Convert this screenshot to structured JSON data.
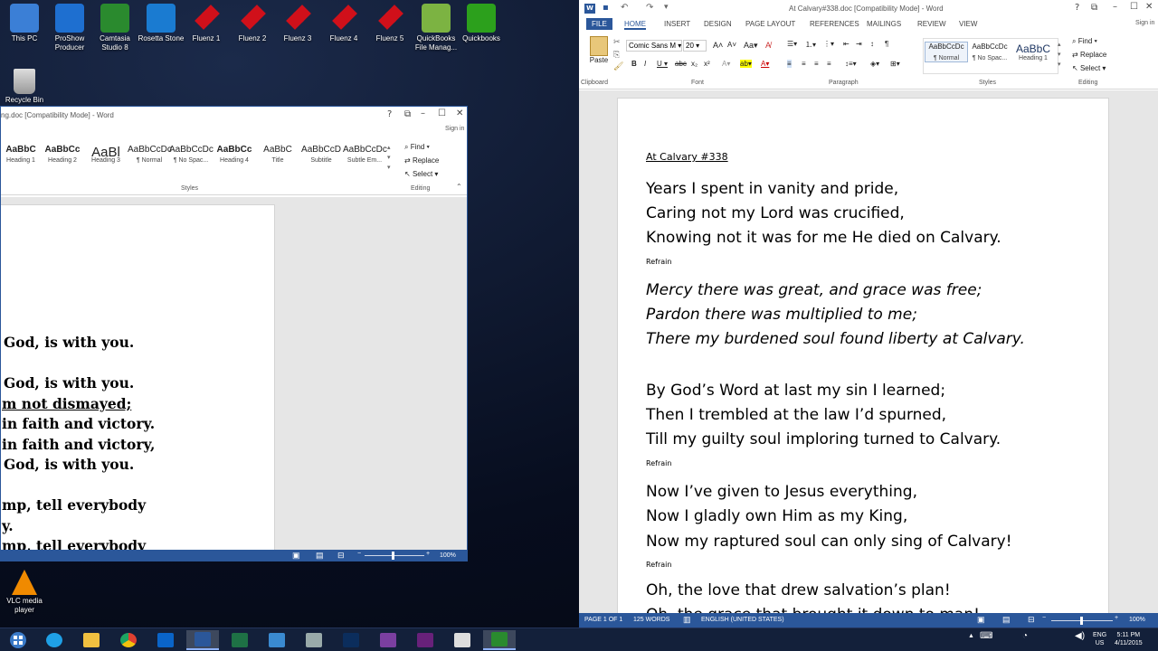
{
  "desktop": {
    "icons": [
      {
        "label": "This PC",
        "icon": "computer-icon",
        "color": "#3b7fd6"
      },
      {
        "label": "ProShow Producer",
        "icon": "proshow-icon",
        "color": "#1e6fd0"
      },
      {
        "label": "Camtasia Studio 8",
        "icon": "camtasia-icon",
        "color": "#2a8a2e"
      },
      {
        "label": "Rosetta Stone",
        "icon": "rosetta-icon",
        "color": "#1a7bd1"
      },
      {
        "label": "Fluenz 1",
        "icon": "fluenz-icon",
        "color": "#d0101a"
      },
      {
        "label": "Fluenz 2",
        "icon": "fluenz-icon",
        "color": "#d0101a"
      },
      {
        "label": "Fluenz 3",
        "icon": "fluenz-icon",
        "color": "#d0101a"
      },
      {
        "label": "Fluenz 4",
        "icon": "fluenz-icon",
        "color": "#d0101a"
      },
      {
        "label": "Fluenz 5",
        "icon": "fluenz-icon",
        "color": "#d0101a"
      },
      {
        "label": "QuickBooks File Manag...",
        "icon": "quickbooks-file-icon",
        "color": "#7cb342"
      },
      {
        "label": "Quickbooks",
        "icon": "quickbooks-icon",
        "color": "#2ca01c"
      }
    ],
    "recycle_bin": "Recycle Bin",
    "vlc": "VLC media player"
  },
  "win1": {
    "title": "ng.doc [Compatibility Mode] - Word",
    "help": "?",
    "sign_in": "Sign in",
    "styles": [
      {
        "sample": "AaBbC",
        "name": "Heading 1"
      },
      {
        "sample": "AaBbCc",
        "name": "Heading 2"
      },
      {
        "sample": "AaBl",
        "name": "Heading 3"
      },
      {
        "sample": "AaBbCcDc",
        "name": "¶ Normal"
      },
      {
        "sample": "AaBbCcDc",
        "name": "¶ No Spac..."
      },
      {
        "sample": "AaBbCc",
        "name": "Heading 4"
      },
      {
        "sample": "AaBbC",
        "name": "Title"
      },
      {
        "sample": "AaBbCcD",
        "name": "Subtitle"
      },
      {
        "sample": "AaBbCcDc",
        "name": "Subtle Em..."
      }
    ],
    "styles_label": "Styles",
    "editing_label": "Editing",
    "find": "Find",
    "replace": "Replace",
    "select": "Select",
    "lines": [
      "God, is with you.",
      "God, is with you.",
      "m not dismayed;",
      "in faith and victory.",
      "in faith and victory,",
      "God, is with you.",
      "mp, tell everybody",
      "y.",
      "mp, tell everybody"
    ],
    "zoom": "100%"
  },
  "win2": {
    "title": "At Calvary#338.doc [Compatibility Mode] - Word",
    "sign_in": "Sign in",
    "help": "?",
    "tabs": [
      "FILE",
      "HOME",
      "INSERT",
      "DESIGN",
      "PAGE LAYOUT",
      "REFERENCES",
      "MAILINGS",
      "REVIEW",
      "VIEW"
    ],
    "font_name": "Comic Sans M",
    "font_size": "20",
    "paste": "Paste",
    "groups": {
      "clipboard": "Clipboard",
      "font": "Font",
      "paragraph": "Paragraph",
      "styles": "Styles",
      "editing": "Editing"
    },
    "styles": [
      {
        "sample": "AaBbCcDc",
        "name": "¶ Normal"
      },
      {
        "sample": "AaBbCcDc",
        "name": "¶ No Spac..."
      },
      {
        "sample": "AaBbC",
        "name": "Heading 1"
      }
    ],
    "find": "Find",
    "replace": "Replace",
    "select": "Select",
    "doc_title": "At Calvary #338",
    "verse1": [
      "Years I spent in vanity and pride,",
      "Caring not my Lord was crucified,",
      "Knowing not it was for me He died on Calvary."
    ],
    "refrain_label": "Refrain",
    "refrain": [
      "Mercy there was great, and grace was free;",
      "Pardon there was multiplied to me;",
      "There my burdened soul found liberty at Calvary."
    ],
    "verse2": [
      "By God’s Word at last my sin I learned;",
      "Then I trembled at the law I’d spurned,",
      "Till my guilty soul imploring turned to Calvary."
    ],
    "verse3": [
      "Now I’ve given to Jesus everything,",
      "Now I gladly own Him as my King,",
      "Now my raptured soul can only sing of Calvary!"
    ],
    "verse4": [
      "Oh, the love that drew salvation’s plan!",
      "Oh, the grace that brought it down to man!"
    ],
    "status": {
      "page": "PAGE 1 OF 1",
      "words": "125 WORDS",
      "lang": "ENGLISH (UNITED STATES)",
      "zoom": "100%"
    }
  },
  "taskbar": {
    "apps": [
      {
        "name": "ie",
        "color": "#1fa0e6"
      },
      {
        "name": "explorer",
        "color": "#f0c040"
      },
      {
        "name": "chrome",
        "color": "#e04030"
      },
      {
        "name": "outlook",
        "color": "#0a64c8"
      },
      {
        "name": "word",
        "color": "#2b579a"
      },
      {
        "name": "excel",
        "color": "#1e7145"
      },
      {
        "name": "remote-desktop",
        "color": "#3a8ad0"
      },
      {
        "name": "settings",
        "color": "#9aa"
      },
      {
        "name": "photoshop",
        "color": "#0b2d5c"
      },
      {
        "name": "onenote-like",
        "color": "#7b3fa0"
      },
      {
        "name": "visual-studio",
        "color": "#68217a"
      },
      {
        "name": "snipping",
        "color": "#ddd"
      },
      {
        "name": "camtasia",
        "color": "#2a8a2e"
      }
    ],
    "lang": "ENG",
    "region": "US",
    "time": "5:11 PM",
    "date": "4/11/2015"
  }
}
